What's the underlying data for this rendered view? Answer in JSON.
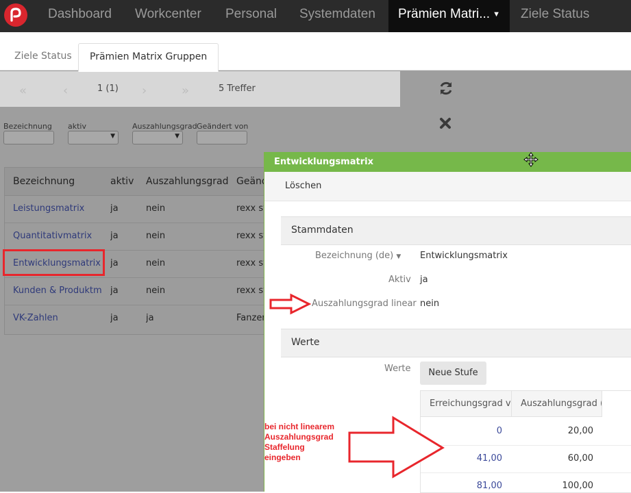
{
  "topnav": {
    "items": [
      "Dashboard",
      "Workcenter",
      "Personal",
      "Systemdaten",
      "Prämien Matri...",
      "Ziele Status"
    ],
    "active_index": 4,
    "logo_icon": "app-logo"
  },
  "subtabs": [
    "Ziele Status",
    "Prämien Matrix Gruppen"
  ],
  "pager": {
    "page_label": "1 (1)",
    "result_count": "5 Treffer",
    "icons": [
      "double-chevron-left-icon",
      "chevron-left-icon",
      "chevron-right-icon",
      "double-chevron-right-icon"
    ]
  },
  "toolbar_icons": [
    "refresh-icon",
    "close-icon"
  ],
  "filters": [
    "Bezeichnung",
    "aktiv",
    "Auszahlungsgrad linear",
    "Geändert von"
  ],
  "grid": {
    "columns": [
      "Bezeichnung",
      "aktiv",
      "Auszahlungsgrad li",
      "Geänd"
    ],
    "rows": [
      [
        "Leistungsmatrix",
        "ja",
        "nein",
        "rexx sy"
      ],
      [
        "Quantitativmatrix",
        "ja",
        "nein",
        "rexx sy"
      ],
      [
        "Entwicklungsmatrix",
        "ja",
        "nein",
        "rexx sy"
      ],
      [
        "Kunden & Produktma",
        "ja",
        "nein",
        "rexx sy"
      ],
      [
        "VK-Zahlen",
        "ja",
        "ja",
        "Fanzer"
      ]
    ]
  },
  "dialog": {
    "title": "Entwicklungsmatrix",
    "delete_label": "Löschen",
    "section_stammdaten": "Stammdaten",
    "fields": [
      {
        "label": "Bezeichnung (de)",
        "value": "Entwicklungsmatrix"
      },
      {
        "label": "Aktiv",
        "value": "ja"
      },
      {
        "label": "Auszahlungsgrad linear",
        "value": "nein"
      }
    ],
    "section_werte": "Werte",
    "werte_label": "Werte",
    "new_level_button": "Neue Stufe",
    "table_columns": [
      "Erreichungsgrad vo",
      "Auszahlungsgrad (%"
    ],
    "table_rows": [
      [
        "0",
        "20,00"
      ],
      [
        "41,00",
        "60,00"
      ],
      [
        "81,00",
        "100,00"
      ]
    ]
  },
  "annotation": [
    "bei nicht linearem",
    "Auszahlungsgrad",
    "Staffelung",
    "eingeben"
  ],
  "colors": {
    "accent_red": "#e8262c",
    "dialog_green": "#76b84a",
    "nav_bg": "#2b2b2b"
  }
}
